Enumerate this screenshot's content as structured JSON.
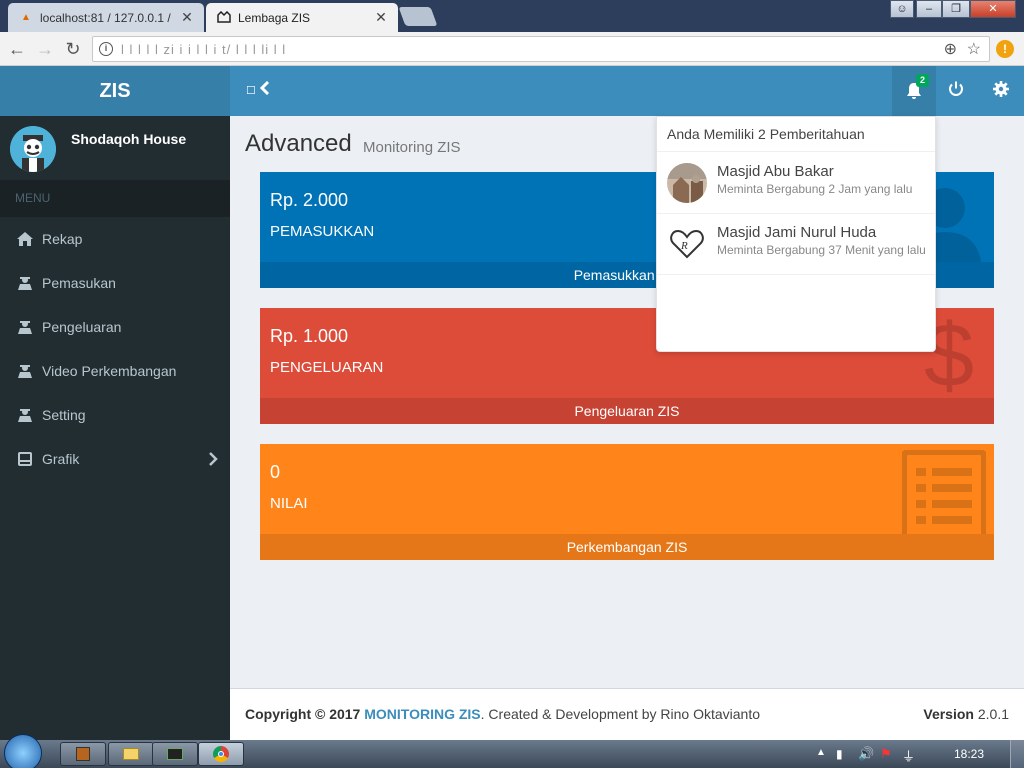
{
  "browser": {
    "tabs": [
      {
        "label": "localhost:81 / 127.0.0.1 /",
        "active": false
      },
      {
        "label": "Lembaga ZIS",
        "active": true
      }
    ],
    "url": "l     l    l  l  l    zi    i i   l l   i  t/  l  l   l       li   l   l"
  },
  "app": {
    "logo": "ZIS",
    "user_name": "Shodaqoh House",
    "menu_header": "MENU",
    "menu": [
      {
        "label": "Rekap",
        "icon": "home-icon"
      },
      {
        "label": "Pemasukan",
        "icon": "user-tie-icon"
      },
      {
        "label": "Pengeluaran",
        "icon": "user-tie-icon"
      },
      {
        "label": "Video Perkembangan",
        "icon": "user-tie-icon"
      },
      {
        "label": "Setting",
        "icon": "user-tie-icon"
      },
      {
        "label": "Grafik",
        "icon": "drive-icon",
        "has_children": true
      }
    ],
    "notification_count": "2"
  },
  "page": {
    "title": "Advanced",
    "subtitle": "Monitoring ZIS"
  },
  "boxes": [
    {
      "value": "Rp. 2.000",
      "label": "PEMASUKKAN",
      "footer": "Pemasukkan ZIS",
      "color": "#0073b7",
      "icon": "user-icon"
    },
    {
      "value": "Rp. 1.000",
      "label": "PENGELUARAN",
      "footer": "Pengeluaran ZIS",
      "color": "#dd4b39",
      "icon": "dollar-icon"
    },
    {
      "value": "0",
      "label": "NILAI",
      "footer": "Perkembangan ZIS",
      "color": "#ff851b",
      "icon": "list-icon"
    }
  ],
  "notifications": {
    "header": "Anda Memiliki 2 Pemberitahuan",
    "items": [
      {
        "title": "Masjid Abu Bakar",
        "text": "Meminta Bergabung 2 Jam yang lalu"
      },
      {
        "title": "Masjid Jami Nurul Huda",
        "text": "Meminta Bergabung 37 Menit yang lalu"
      }
    ]
  },
  "footer": {
    "copyright_prefix": "Copyright © 2017",
    "brand": "MONITORING ZIS",
    "created": ". Created & Development by Rino Oktavianto",
    "version_label": "Version",
    "version": "2.0.1"
  },
  "taskbar": {
    "clock": "18:23"
  }
}
